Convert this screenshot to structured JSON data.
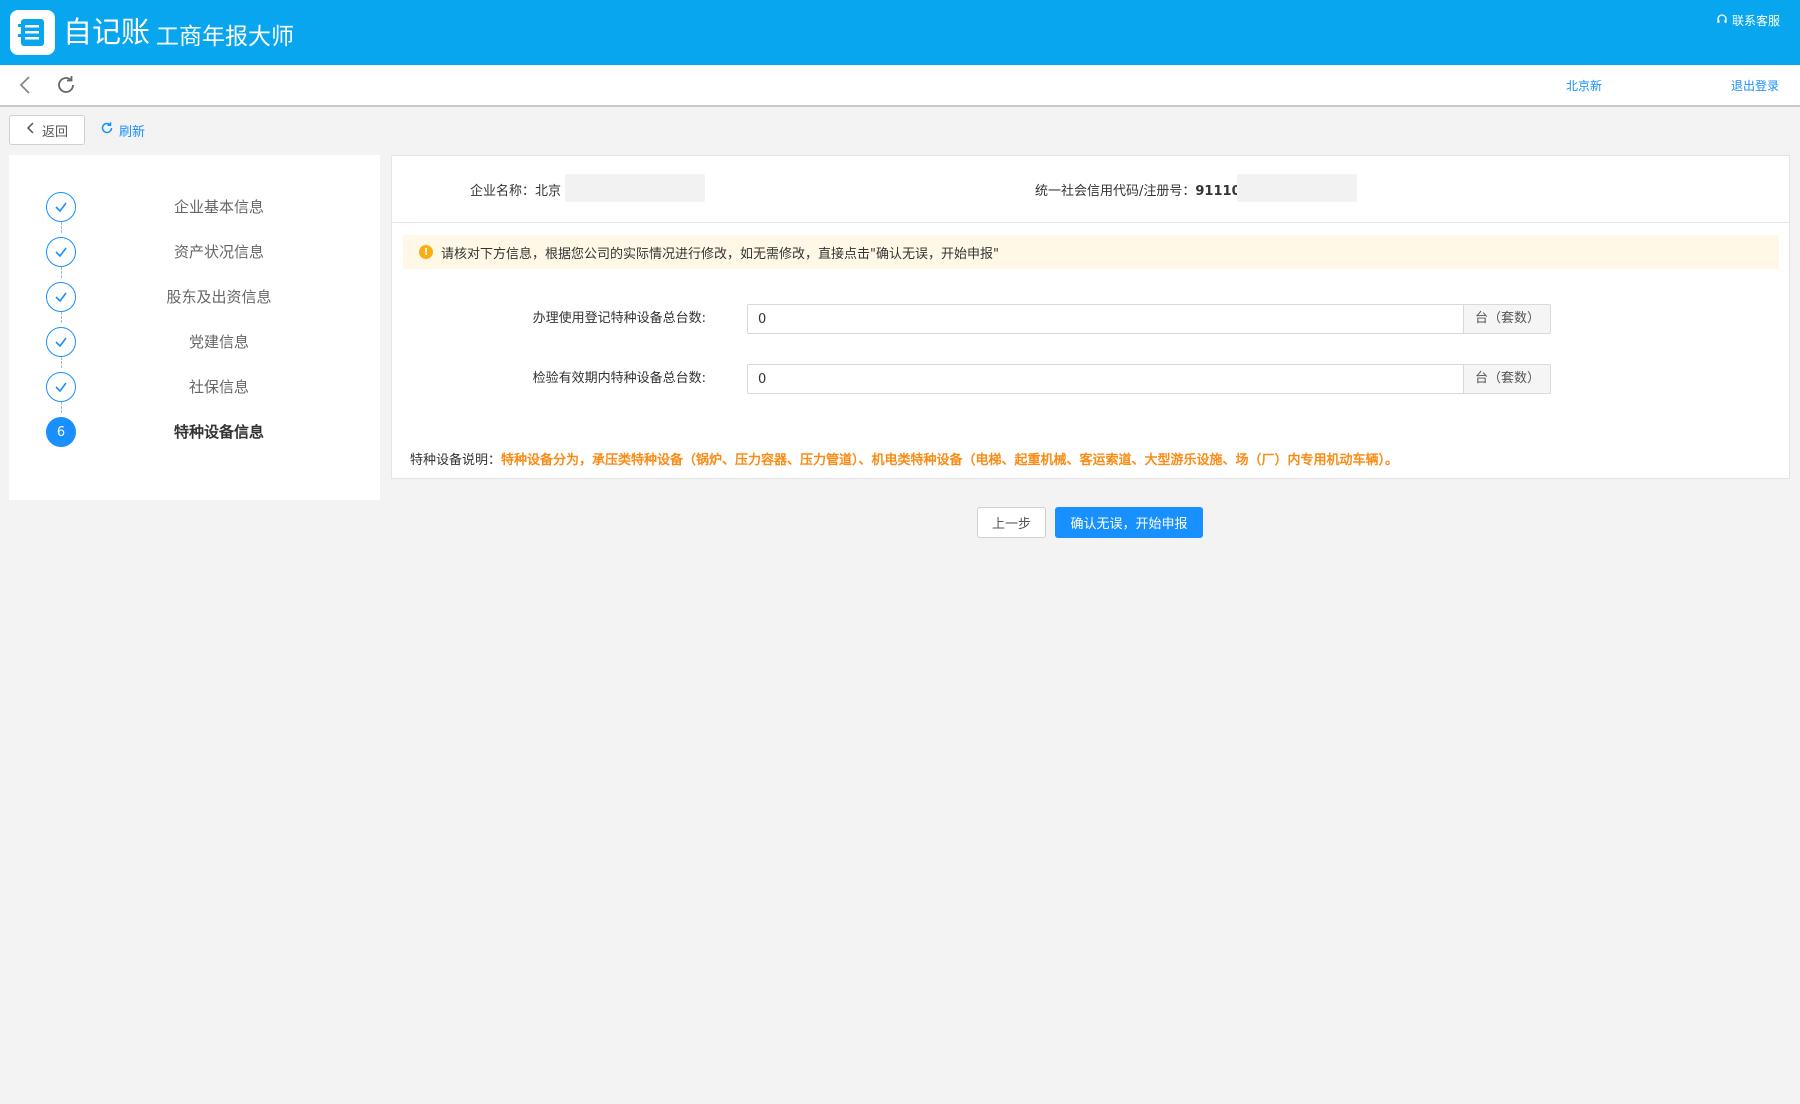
{
  "header": {
    "brand": "自记账",
    "subtitle": "工商年报大师",
    "support_label": "联系客服",
    "brand_color": "#08a6ef"
  },
  "navbar": {
    "user_name": "北京新",
    "logout_label": "退出登录"
  },
  "toolbar": {
    "back_label": "返回",
    "refresh_label": "刷新"
  },
  "steps": [
    {
      "label": "企业基本信息",
      "state": "done"
    },
    {
      "label": "资产状况信息",
      "state": "done"
    },
    {
      "label": "股东及出资信息",
      "state": "done"
    },
    {
      "label": "党建信息",
      "state": "done"
    },
    {
      "label": "社保信息",
      "state": "done"
    },
    {
      "label": "特种设备信息",
      "state": "active",
      "number": "6"
    }
  ],
  "company": {
    "name_label": "企业名称：北京",
    "credit_label": "统一社会信用代码/注册号：",
    "credit_value": "91110"
  },
  "notice": {
    "text": "请核对下方信息，根据您公司的实际情况进行修改，如无需修改，直接点击\"确认无误，开始申报\""
  },
  "form": {
    "fields": [
      {
        "label": "办理使用登记特种设备总台数:",
        "value": "0",
        "suffix": "台（套数）"
      },
      {
        "label": "检验有效期内特种设备总台数:",
        "value": "0",
        "suffix": "台（套数）"
      }
    ]
  },
  "description": {
    "label": "特种设备说明：",
    "text": "特种设备分为，承压类特种设备（锅炉、压力容器、压力管道）、机电类特种设备（电梯、起重机械、客运索道、大型游乐设施、场（厂）内专用机动车辆）。"
  },
  "actions": {
    "prev_label": "上一步",
    "confirm_label": "确认无误，开始申报"
  },
  "colors": {
    "primary": "#1890ff",
    "warning": "#faad14",
    "highlight": "#fa8c16"
  }
}
